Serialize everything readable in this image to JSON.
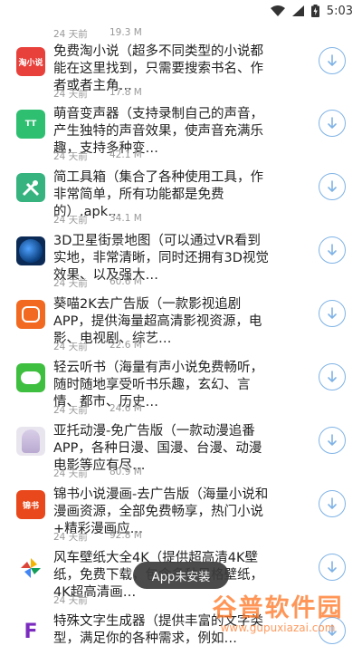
{
  "status_bar": {
    "time": "5:03"
  },
  "partial_top": {
    "time": "24 天前",
    "size": "19.3 M"
  },
  "items": [
    {
      "title": "免费淘小说（超多不同类型的小说都能在这里找到，只需要搜索书名、作者或者主角…",
      "time": "24 天前",
      "size": "17.8 M",
      "icon": "novel-app-icon",
      "icon_text": "淘小说",
      "color": "#e8413b"
    },
    {
      "title": "萌音变声器（支持录制自己的声音，产生独特的声音效果，使声音充满乐趣，支持多种变…",
      "time": "24 天前",
      "size": "42.1 M",
      "icon": "voice-changer-icon",
      "icon_text": "TT",
      "color": "#2fbf71"
    },
    {
      "title": "简工具箱（集合了各种使用工具，作非常简单，所有功能都是免费的）.apk…",
      "time": "24 天前",
      "size": "34.1 M",
      "icon": "toolbox-icon",
      "icon_text": "",
      "color": "#37b37f"
    },
    {
      "title": "3D卫星街景地图（可以通过VR看到实地，非常清晰，同时还拥有3D视觉效果、以及强大…",
      "time": "24 天前",
      "size": "60.6 M",
      "icon": "earth-map-icon",
      "icon_text": "",
      "color": "#0b2a56"
    },
    {
      "title": "葵喵2K去广告版（一款影视追剧APP，提供海量超高清影视资源，电影、电视剧、综艺…",
      "time": "24 天前",
      "size": "22.6 M",
      "icon": "video-app-icon",
      "icon_text": "",
      "color": "#f26a21"
    },
    {
      "title": "轻云听书（海量有声小说免费畅听，随时随地享受听书乐趣，玄幻、言情、都市、历史…",
      "time": "24 天前",
      "size": "24.6 M",
      "icon": "cloud-audiobook-icon",
      "icon_text": "",
      "color": "#3fbf3f"
    },
    {
      "title": "亚托动漫-免广告版（一款动漫追番APP，各种日漫、国漫、台漫、动漫电影等应有尽…",
      "time": "24 天前",
      "size": "80.9 M",
      "icon": "anime-app-icon",
      "icon_text": "",
      "color": "#e9e5ef"
    },
    {
      "title": "锦书小说漫画-去广告版（海量小说和漫画资源，全部免费畅享，热门小说+精彩漫画应…",
      "time": "24 天前",
      "size": "92.8 M",
      "icon": "jinshu-app-icon",
      "icon_text": "锦书",
      "color": "#e8481c"
    },
    {
      "title": "风车壁纸大全4K（提供超高清4K壁纸，免费下载，包含多种风格壁纸，4K超高清画…",
      "time": "24 天前",
      "size": "",
      "icon": "pinwheel-wallpaper-icon",
      "icon_text": "",
      "color": "#ffffff"
    },
    {
      "title": "特殊文字生成器（提供丰富的文字类型，满足你的各种需求，例如…",
      "time": "",
      "size": "",
      "icon": "text-generator-icon",
      "icon_text": "F",
      "color": "#ffffff"
    }
  ],
  "toast": "App未安装",
  "watermark": {
    "line1": "谷普软件园",
    "line2": "www.gupuxiazai.com"
  }
}
